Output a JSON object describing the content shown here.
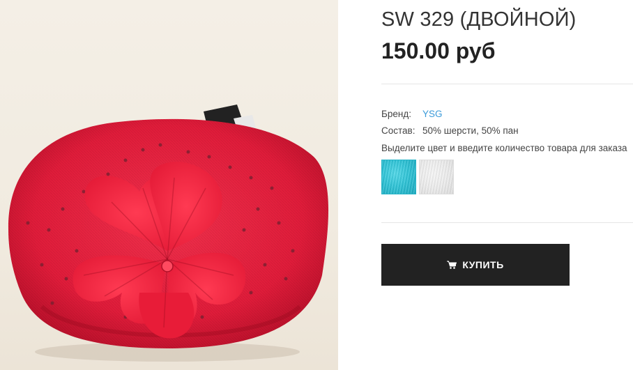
{
  "product": {
    "title": "SW 329 (ДВОЙНОЙ)",
    "price": "150.00 руб",
    "image_alt": "red beret with flower",
    "brand_label": "Бренд:",
    "brand_value": "YSG",
    "composition_label": "Состав:",
    "composition_value": "50% шерсти, 50% пан",
    "color_hint": "Выделите цвет и введите количество товара для заказа",
    "colors": [
      {
        "name": "turquoise",
        "hex": "#2ec3d6"
      },
      {
        "name": "white",
        "hex": "#ececec"
      }
    ]
  },
  "actions": {
    "buy_label": "КУПИТЬ",
    "buy_icon": "cart-icon"
  },
  "colors": {
    "button_bg": "#222222",
    "link": "#3a9ad9",
    "hat_red": "#e8213f"
  }
}
